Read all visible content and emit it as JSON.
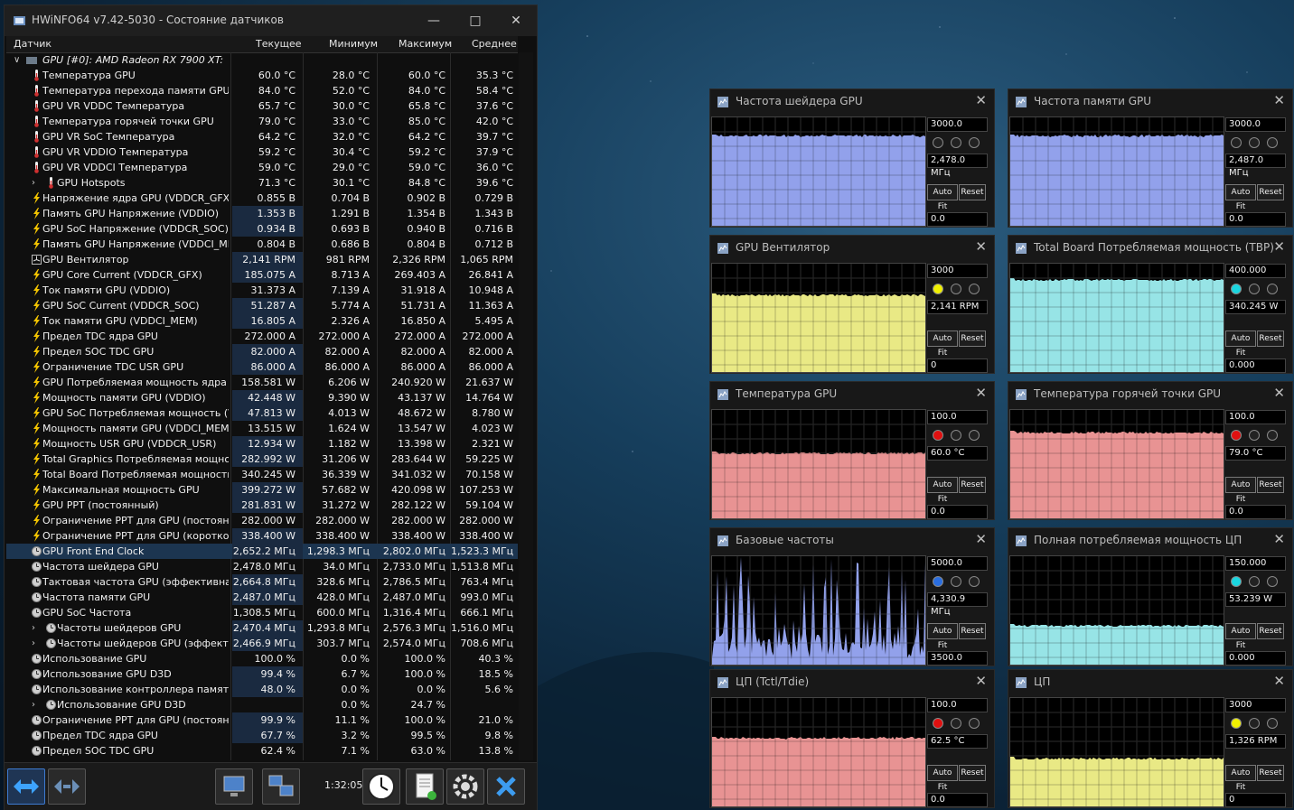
{
  "window": {
    "title": "HWiNFO64 v7.42-5030 - Состояние датчиков",
    "columns": [
      "Датчик",
      "Текущее",
      "Минимум",
      "Максимум",
      "Среднее"
    ],
    "group": "GPU [#0]: AMD Radeon RX 7900 XT:",
    "timer": "1:32:05"
  },
  "rows": [
    {
      "name": "Температура GPU",
      "cur": "60.0 °C",
      "min": "28.0 °C",
      "max": "60.0 °C",
      "avg": "35.3 °C",
      "icon": "thermometer-icon"
    },
    {
      "name": "Температура перехода памяти GPU",
      "cur": "84.0 °C",
      "min": "52.0 °C",
      "max": "84.0 °C",
      "avg": "58.4 °C",
      "icon": "thermometer-icon"
    },
    {
      "name": "GPU VR VDDC Температура",
      "cur": "65.7 °C",
      "min": "30.0 °C",
      "max": "65.8 °C",
      "avg": "37.6 °C",
      "icon": "thermometer-icon"
    },
    {
      "name": "Температура горячей точки GPU",
      "cur": "79.0 °C",
      "min": "33.0 °C",
      "max": "85.0 °C",
      "avg": "42.0 °C",
      "icon": "thermometer-icon"
    },
    {
      "name": "GPU VR SoC Температура",
      "cur": "64.2 °C",
      "min": "32.0 °C",
      "max": "64.2 °C",
      "avg": "39.7 °C",
      "icon": "thermometer-icon"
    },
    {
      "name": "GPU VR VDDIO Температура",
      "cur": "59.2 °C",
      "min": "30.4 °C",
      "max": "59.2 °C",
      "avg": "37.9 °C",
      "icon": "thermometer-icon"
    },
    {
      "name": "GPU VR VDDCI Температура",
      "cur": "59.0 °C",
      "min": "29.0 °C",
      "max": "59.0 °C",
      "avg": "36.0 °C",
      "icon": "thermometer-icon"
    },
    {
      "name": "GPU Hotspots",
      "cur": "71.3 °C",
      "min": "30.1 °C",
      "max": "84.8 °C",
      "avg": "39.6 °C",
      "icon": "thermometer-icon",
      "expand": true
    },
    {
      "name": "Напряжение ядра GPU (VDDCR_GFX)",
      "cur": "0.855 В",
      "min": "0.704 В",
      "max": "0.902 В",
      "avg": "0.729 В",
      "icon": "bolt-icon"
    },
    {
      "name": "Память GPU Напряжение (VDDIO)",
      "cur": "1.353 В",
      "min": "1.291 В",
      "max": "1.354 В",
      "avg": "1.343 В",
      "icon": "bolt-icon"
    },
    {
      "name": "GPU SoC Напряжение (VDDCR_SOC)",
      "cur": "0.934 В",
      "min": "0.693 В",
      "max": "0.940 В",
      "avg": "0.716 В",
      "icon": "bolt-icon"
    },
    {
      "name": "Память GPU Напряжение (VDDCI_MEM)",
      "cur": "0.804 В",
      "min": "0.686 В",
      "max": "0.804 В",
      "avg": "0.712 В",
      "icon": "bolt-icon"
    },
    {
      "name": "GPU Вентилятор",
      "cur": "2,141 RPM",
      "min": "981 RPM",
      "max": "2,326 RPM",
      "avg": "1,065 RPM",
      "icon": "fan-icon"
    },
    {
      "name": "GPU Core Current (VDDCR_GFX)",
      "cur": "185.075 A",
      "min": "8.713 A",
      "max": "269.403 A",
      "avg": "26.841 A",
      "icon": "bolt-icon"
    },
    {
      "name": "Ток памяти GPU (VDDIO)",
      "cur": "31.373 A",
      "min": "7.139 A",
      "max": "31.918 A",
      "avg": "10.948 A",
      "icon": "bolt-icon"
    },
    {
      "name": "GPU SoC Current (VDDCR_SOC)",
      "cur": "51.287 A",
      "min": "5.774 A",
      "max": "51.731 A",
      "avg": "11.363 A",
      "icon": "bolt-icon"
    },
    {
      "name": "Ток памяти GPU (VDDCI_MEM)",
      "cur": "16.805 A",
      "min": "2.326 A",
      "max": "16.850 A",
      "avg": "5.495 A",
      "icon": "bolt-icon"
    },
    {
      "name": "Предел TDC ядра GPU",
      "cur": "272.000 A",
      "min": "272.000 A",
      "max": "272.000 A",
      "avg": "272.000 A",
      "icon": "bolt-icon"
    },
    {
      "name": "Предел SOC TDC GPU",
      "cur": "82.000 A",
      "min": "82.000 A",
      "max": "82.000 A",
      "avg": "82.000 A",
      "icon": "bolt-icon"
    },
    {
      "name": "Ограничение TDC USR GPU",
      "cur": "86.000 A",
      "min": "86.000 A",
      "max": "86.000 A",
      "avg": "86.000 A",
      "icon": "bolt-icon"
    },
    {
      "name": "GPU Потребляемая мощность ядра (V...",
      "cur": "158.581 W",
      "min": "6.206 W",
      "max": "240.920 W",
      "avg": "21.637 W",
      "icon": "bolt-icon"
    },
    {
      "name": "Мощность памяти GPU (VDDIO)",
      "cur": "42.448 W",
      "min": "9.390 W",
      "max": "43.137 W",
      "avg": "14.764 W",
      "icon": "bolt-icon"
    },
    {
      "name": "GPU SoC Потребляемая мощность (VD...",
      "cur": "47.813 W",
      "min": "4.013 W",
      "max": "48.672 W",
      "avg": "8.780 W",
      "icon": "bolt-icon"
    },
    {
      "name": "Мощность памяти GPU (VDDCI_MEM)",
      "cur": "13.515 W",
      "min": "1.624 W",
      "max": "13.547 W",
      "avg": "4.023 W",
      "icon": "bolt-icon"
    },
    {
      "name": "Мощность USR GPU (VDDCR_USR)",
      "cur": "12.934 W",
      "min": "1.182 W",
      "max": "13.398 W",
      "avg": "2.321 W",
      "icon": "bolt-icon"
    },
    {
      "name": "Total Graphics Потребляемая мощност...",
      "cur": "282.992 W",
      "min": "31.206 W",
      "max": "283.644 W",
      "avg": "59.225 W",
      "icon": "bolt-icon"
    },
    {
      "name": "Total Board Потребляемая мощность (...",
      "cur": "340.245 W",
      "min": "36.339 W",
      "max": "341.032 W",
      "avg": "70.158 W",
      "icon": "bolt-icon"
    },
    {
      "name": "Максимальная мощность GPU",
      "cur": "399.272 W",
      "min": "57.682 W",
      "max": "420.098 W",
      "avg": "107.253 W",
      "icon": "bolt-icon"
    },
    {
      "name": "GPU PPT (постоянный)",
      "cur": "281.831 W",
      "min": "31.272 W",
      "max": "282.122 W",
      "avg": "59.104 W",
      "icon": "bolt-icon"
    },
    {
      "name": "Ограничение PPT для GPU (постоянное)",
      "cur": "282.000 W",
      "min": "282.000 W",
      "max": "282.000 W",
      "avg": "282.000 W",
      "icon": "bolt-icon"
    },
    {
      "name": "Ограничение PPT для GPU (короткое)",
      "cur": "338.400 W",
      "min": "338.400 W",
      "max": "338.400 W",
      "avg": "338.400 W",
      "icon": "bolt-icon"
    },
    {
      "name": "GPU Front End Clock",
      "cur": "2,652.2 МГц",
      "min": "1,298.3 МГц",
      "max": "2,802.0 МГц",
      "avg": "1,523.3 МГц",
      "icon": "clock-icon",
      "selected": true
    },
    {
      "name": "Частота шейдера GPU",
      "cur": "2,478.0 МГц",
      "min": "34.0 МГц",
      "max": "2,733.0 МГц",
      "avg": "1,513.8 МГц",
      "icon": "clock-icon"
    },
    {
      "name": "Тактовая частота GPU (эффективная)",
      "cur": "2,664.8 МГц",
      "min": "328.6 МГц",
      "max": "2,786.5 МГц",
      "avg": "763.4 МГц",
      "icon": "clock-icon"
    },
    {
      "name": "Частота памяти GPU",
      "cur": "2,487.0 МГц",
      "min": "428.0 МГц",
      "max": "2,487.0 МГц",
      "avg": "993.0 МГц",
      "icon": "clock-icon"
    },
    {
      "name": "GPU SoC Частота",
      "cur": "1,308.5 МГц",
      "min": "600.0 МГц",
      "max": "1,316.4 МГц",
      "avg": "666.1 МГц",
      "icon": "clock-icon"
    },
    {
      "name": "Частоты шейдеров GPU",
      "cur": "2,470.4 МГц",
      "min": "1,293.8 МГц",
      "max": "2,576.3 МГц",
      "avg": "1,516.0 МГц",
      "icon": "clock-icon",
      "expand": true
    },
    {
      "name": "Частоты шейдеров GPU (эффекти...",
      "cur": "2,466.9 МГц",
      "min": "303.7 МГц",
      "max": "2,574.0 МГц",
      "avg": "708.6 МГц",
      "icon": "clock-icon",
      "expand": true
    },
    {
      "name": "Использование GPU",
      "cur": "100.0 %",
      "min": "0.0 %",
      "max": "100.0 %",
      "avg": "40.3 %",
      "icon": "clock-icon"
    },
    {
      "name": "Использование GPU D3D",
      "cur": "99.4 %",
      "min": "6.7 %",
      "max": "100.0 %",
      "avg": "18.5 %",
      "icon": "clock-icon"
    },
    {
      "name": "Использование контроллера памяти ...",
      "cur": "48.0 %",
      "min": "0.0 %",
      "max": "0.0 %",
      "avg": "5.6 %",
      "icon": "clock-icon"
    },
    {
      "name": "Использование GPU D3D",
      "cur": "",
      "min": "0.0 %",
      "max": "24.7 %",
      "avg": "",
      "icon": "clock-icon",
      "expand": true
    },
    {
      "name": "Ограничение PPT для GPU (постоянное)",
      "cur": "99.9 %",
      "min": "11.1 %",
      "max": "100.0 %",
      "avg": "21.0 %",
      "icon": "clock-icon"
    },
    {
      "name": "Предел TDC ядра GPU",
      "cur": "67.7 %",
      "min": "3.2 %",
      "max": "99.5 %",
      "avg": "9.8 %",
      "icon": "clock-icon"
    },
    {
      "name": "Предел SOC TDC GPU",
      "cur": "62.4 %",
      "min": "7.1 %",
      "max": "63.0 %",
      "avg": "13.8 %",
      "icon": "clock-icon"
    }
  ],
  "graphs": [
    {
      "title": "Частота шейдера GPU",
      "max": "3000.0",
      "value": "2,478.0 МГц",
      "min": "0.0",
      "color": "#9aaaf8",
      "level": 0.83,
      "noise": "flat",
      "dot": 0,
      "auto_fit": "Auto Fit",
      "reset": "Reset"
    },
    {
      "title": "Частота памяти GPU",
      "max": "3000.0",
      "value": "2,487.0 МГц",
      "min": "0.0",
      "color": "#9aaaf8",
      "level": 0.83,
      "noise": "flat",
      "dot": 0,
      "auto_fit": "Auto Fit",
      "reset": "Reset"
    },
    {
      "title": "GPU Вентилятор",
      "max": "3000",
      "value": "2,141 RPM",
      "min": "0",
      "color": "#f6f68c",
      "level": 0.71,
      "noise": "flat",
      "dot": 1,
      "dotColor": "#f0f000",
      "auto_fit": "Auto Fit",
      "reset": "Reset"
    },
    {
      "title": "Total Board Потребляемая мощность (TBP)",
      "max": "400.000",
      "value": "340.245 W",
      "min": "0.000",
      "color": "#9ff0f2",
      "level": 0.85,
      "noise": "flat",
      "dot": 1,
      "dotColor": "#1ad6e0",
      "auto_fit": "Auto Fit",
      "reset": "Reset"
    },
    {
      "title": "Температура GPU",
      "max": "100.0",
      "value": "60.0 °C",
      "min": "0.0",
      "color": "#f49b9b",
      "level": 0.6,
      "noise": "flat",
      "dot": 1,
      "dotColor": "#e01010",
      "auto_fit": "Auto Fit",
      "reset": "Reset"
    },
    {
      "title": "Температура горячей точки GPU",
      "max": "100.0",
      "value": "79.0 °C",
      "min": "0.0",
      "color": "#f49b9b",
      "level": 0.79,
      "noise": "flat",
      "dot": 1,
      "dotColor": "#e01010",
      "auto_fit": "Auto Fit",
      "reset": "Reset"
    },
    {
      "title": "Базовые частоты",
      "max": "5000.0",
      "value": "4,330.9 МГц",
      "min": "3500.0",
      "color": "#9aaaf8",
      "level": 0.4,
      "noise": "spiky",
      "dot": 1,
      "dotColor": "#2a6ee0",
      "auto_fit": "Auto Fit",
      "reset": "Reset"
    },
    {
      "title": "Полная потребляемая мощность ЦП",
      "max": "150.000",
      "value": "53.239 W",
      "min": "0.000",
      "color": "#9ff0f2",
      "level": 0.36,
      "noise": "flat",
      "dot": 1,
      "dotColor": "#1ad6e0",
      "auto_fit": "Auto Fit",
      "reset": "Reset"
    },
    {
      "title": "ЦП (Tctl/Tdie)",
      "max": "100.0",
      "value": "62.5 °C",
      "min": "0.0",
      "color": "#f49b9b",
      "level": 0.63,
      "noise": "flat",
      "dot": 1,
      "dotColor": "#e01010",
      "auto_fit": "Auto Fit",
      "reset": "Reset"
    },
    {
      "title": "ЦП",
      "max": "3000",
      "value": "1,326 RPM",
      "min": "0",
      "color": "#f6f68c",
      "level": 0.44,
      "noise": "flat",
      "dot": 1,
      "dotColor": "#f0f000",
      "auto_fit": "Auto Fit",
      "reset": "Reset"
    }
  ]
}
